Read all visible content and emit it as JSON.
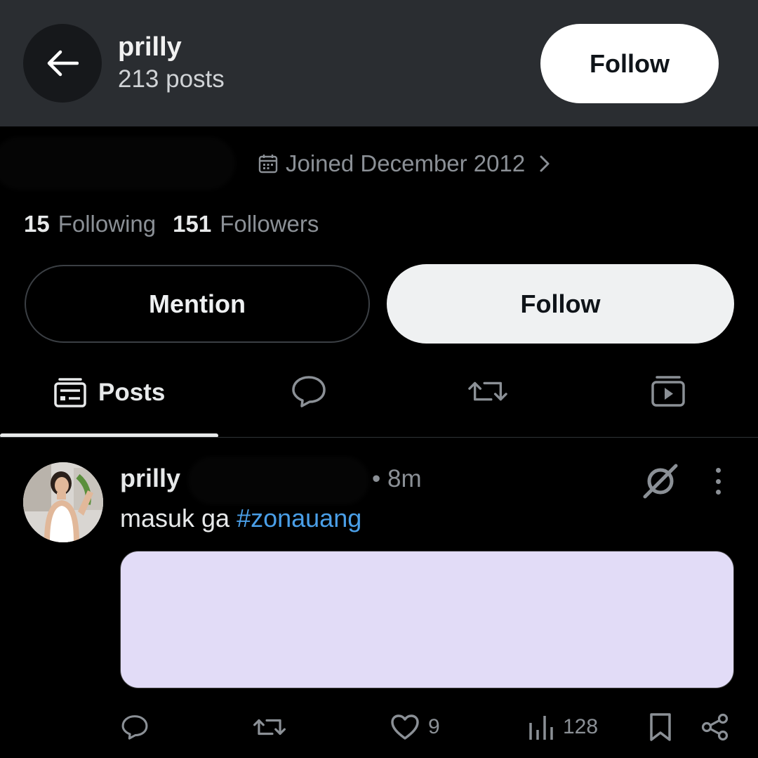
{
  "header": {
    "name": "prilly",
    "posts_count": "213 posts",
    "follow_label": "Follow"
  },
  "profile": {
    "joined": "Joined December 2012",
    "following_count": "15",
    "following_label": "Following",
    "followers_count": "151",
    "followers_label": "Followers",
    "mention_label": "Mention",
    "follow_label": "Follow"
  },
  "tabs": [
    {
      "label": "Posts",
      "icon": "posts-icon",
      "active": true
    },
    {
      "label": "",
      "icon": "replies-icon",
      "active": false
    },
    {
      "label": "",
      "icon": "reposts-icon",
      "active": false
    },
    {
      "label": "",
      "icon": "media-icon",
      "active": false
    }
  ],
  "post": {
    "author": "prilly",
    "time": "• 8m",
    "text_plain": "masuk ga ",
    "hashtag": "#zonauang",
    "like_count": "9",
    "view_count": "128"
  },
  "colors": {
    "header_bg": "#2a2d31",
    "background": "#000000",
    "hashtag": "#4a9fe8",
    "media_card": "#e2dcf7",
    "secondary_text": "#8b9096"
  }
}
